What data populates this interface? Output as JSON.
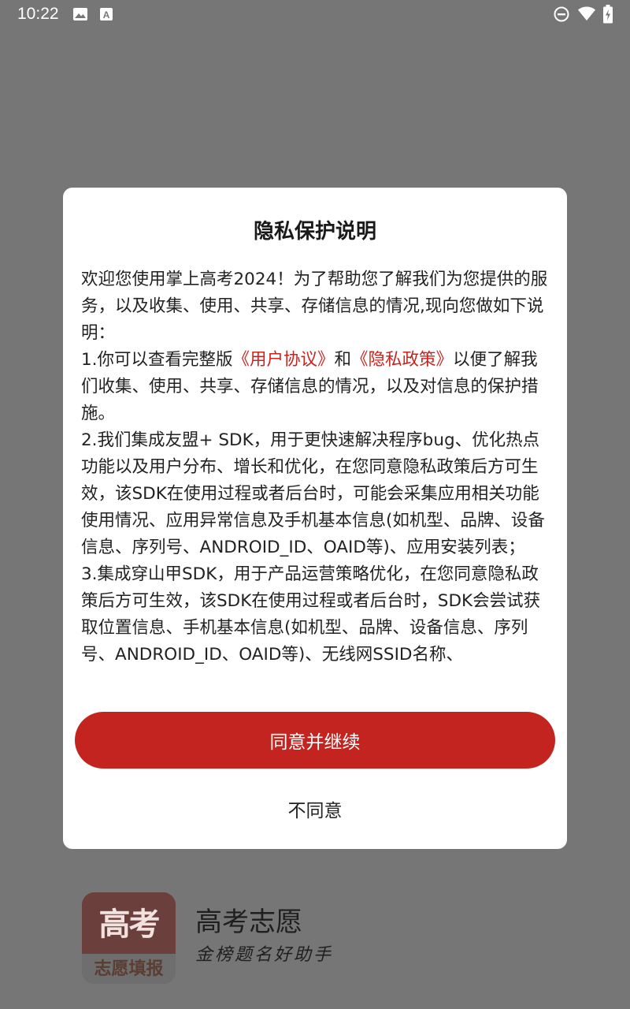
{
  "status_bar": {
    "time": "10:22",
    "left_icons": [
      "image-icon",
      "font-a-icon"
    ],
    "right_icons": [
      "do-not-disturb-icon",
      "wifi-icon",
      "battery-icon"
    ]
  },
  "dialog": {
    "title": "隐私保护说明",
    "intro": "欢迎您使用掌上高考2024！为了帮助您了解我们为您提供的服务，以及收集、使用、共享、存储信息的情况,现向您做如下说明：",
    "item1_prefix": "1.你可以查看完整版",
    "user_agreement_link": "《用户协议》",
    "item1_and": "和",
    "privacy_policy_link": "《隐私政策》",
    "item1_suffix": "以便了解我们收集、使用、共享、存储信息的情况，以及对信息的保护措施。",
    "item2": "2.我们集成友盟+ SDK，用于更快速解决程序bug、优化热点功能以及用户分布、增长和优化，在您同意隐私政策后方可生效，该SDK在使用过程或者后台时，可能会采集应用相关功能使用情况、应用异常信息及手机基本信息(如机型、品牌、设备信息、序列号、ANDROID_ID、OAID等)、应用安装列表；",
    "item3": "3.集成穿山甲SDK，用于产品运营策略优化，在您同意隐私政策后方可生效，该SDK在使用过程或者后台时，SDK会尝试获取位置信息、手机基本信息(如机型、品牌、设备信息、序列号、ANDROID_ID、OAID等)、无线网SSID名称、",
    "agree_label": "同意并继续",
    "disagree_label": "不同意"
  },
  "brand": {
    "logo_top": "高考",
    "logo_bottom": "志愿填报",
    "name": "高考志愿",
    "slogan": "金榜题名好助手"
  },
  "colors": {
    "accent": "#c4241f",
    "link": "#c8231f",
    "scrim": "#767676",
    "dialog_bg": "#ffffff"
  }
}
